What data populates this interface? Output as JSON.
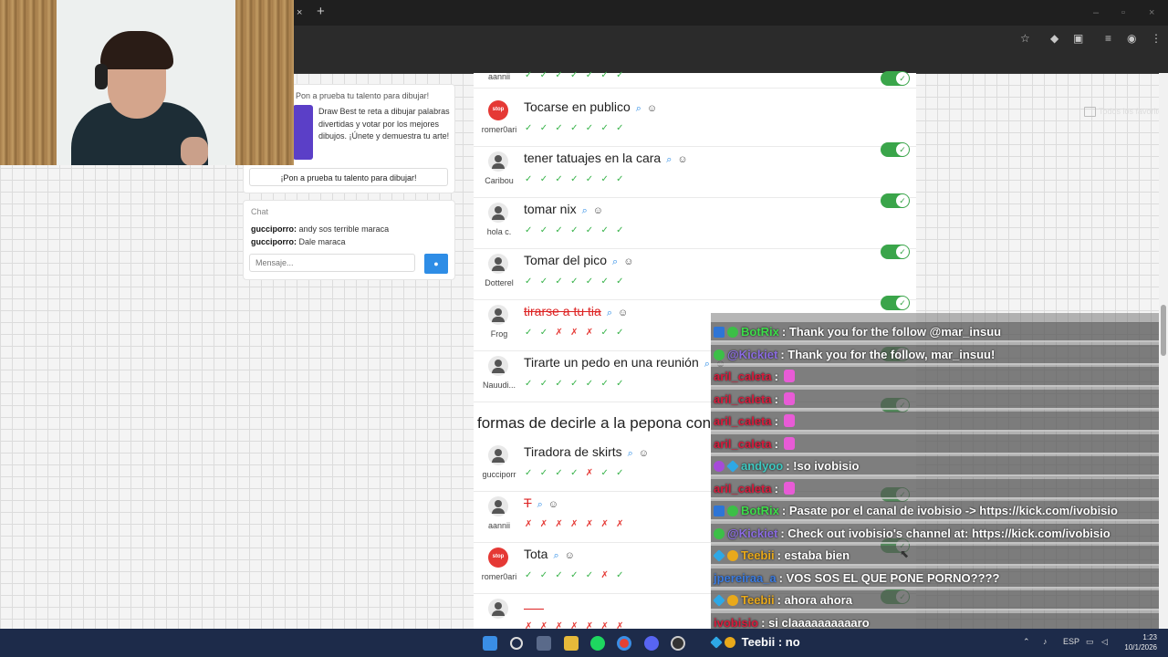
{
  "browser": {
    "tab_close": "×",
    "new_tab": "+",
    "bookmarks_folder_label": "Todos los favoritos"
  },
  "sidebar": {
    "promo_title": "Pon a prueba tu talento para dibujar!",
    "promo_text": "Draw Best te reta a dibujar palabras divertidas y votar por los mejores dibujos. ¡Únete y demuestra tu arte!",
    "promo_button": "¡Pon a prueba tu talento para dibujar!",
    "chat_title": "Chat",
    "chat_messages": [
      {
        "user": "gucciporro:",
        "text": "andy sos terrible maraca"
      },
      {
        "user": "gucciporro:",
        "text": "Dale maraca"
      }
    ],
    "chat_placeholder": "Mensaje..."
  },
  "list": {
    "top_partial_user": "aannii",
    "rows": [
      {
        "title": "Tocarse en publico",
        "user": "romer0ari",
        "stop": true,
        "marks": "✓✓✓✓✓✓✓"
      },
      {
        "title": "tener tatuajes en la cara",
        "user": "Caribou",
        "stop": false,
        "marks": "✓✓✓✓✓✓✓"
      },
      {
        "title": "tomar nix",
        "user": "hola c.",
        "stop": false,
        "marks": "✓✓✓✓✓✓✓"
      },
      {
        "title": "Tomar del pico",
        "user": "Dotterel",
        "stop": false,
        "marks": "✓✓✓✓✓✓✓"
      },
      {
        "title": "tirarse a tu tia",
        "user": "Frog",
        "stop": false,
        "strike": true,
        "marks": "✓✓✗✗✗✓✓"
      },
      {
        "title": "Tirarte un pedo en una reunión",
        "user": "Nauudi...",
        "stop": false,
        "marks": "✓✓✓✓✓✓✓"
      }
    ],
    "section_title": "formas de decirle a la pepona con",
    "rows2": [
      {
        "title": "Tiradora de skirts",
        "user": "gucciporr",
        "stop": false,
        "marks": "✓✓✓✓✗✓✓"
      },
      {
        "title": "T",
        "user": "aannii",
        "stop": false,
        "strike": true,
        "marks": "✗✗✗✗✗✗✗"
      },
      {
        "title": "Tota",
        "user": "romer0ari",
        "stop": true,
        "marks": "✓✓✓✓✓✗✓"
      },
      {
        "title": "",
        "user": "",
        "stop": false,
        "marks": "✗✗✗✗✗✗✗"
      }
    ],
    "stop_label": "stop"
  },
  "stream_chat": {
    "messages": [
      {
        "badges": [
          "bot",
          "ok"
        ],
        "nick": "BotRix",
        "nick_color": "#3ddc4a",
        "text": ": Thank you for the follow @mar_insuu"
      },
      {
        "badges": [
          "ok"
        ],
        "nick": "@Kickiet",
        "nick_color": "#8a6be0",
        "text": ": Thank you for the follow, mar_insuu!"
      },
      {
        "badges": [],
        "nick": "aril_caleta",
        "nick_color": "#d81b3c",
        "text": ":",
        "emote": true
      },
      {
        "badges": [],
        "nick": "aril_caleta",
        "nick_color": "#d81b3c",
        "text": ":",
        "emote": true
      },
      {
        "badges": [],
        "nick": "aril_caleta",
        "nick_color": "#d81b3c",
        "text": ":",
        "emote": true
      },
      {
        "badges": [],
        "nick": "aril_caleta",
        "nick_color": "#d81b3c",
        "text": ":",
        "emote": true
      },
      {
        "badges": [
          "gem",
          "hex"
        ],
        "nick": "andyoo",
        "nick_color": "#3ec9c1",
        "text": ": !so ivobisio"
      },
      {
        "badges": [],
        "nick": "aril_caleta",
        "nick_color": "#d81b3c",
        "text": ":",
        "emote": true
      },
      {
        "badges": [
          "bot",
          "ok"
        ],
        "nick": "BotRix",
        "nick_color": "#3ddc4a",
        "text": ": Pasate por el canal de ivobisio -> https://kick.com/ivobisio"
      },
      {
        "badges": [
          "ok"
        ],
        "nick": "@Kickiet",
        "nick_color": "#8a6be0",
        "text": ": Check out ivobisio's channel at: https://kick.com/ivobisio"
      },
      {
        "badges": [
          "hex",
          "gold"
        ],
        "nick": "Teebii",
        "nick_color": "#e9a91a",
        "text": ": estaba bien"
      },
      {
        "badges": [],
        "nick": "jpereiraa_a",
        "nick_color": "#3a7be0",
        "text": ": VOS SOS EL QUE PONE PORNO????"
      },
      {
        "badges": [
          "hex",
          "gold"
        ],
        "nick": "Teebii",
        "nick_color": "#e9a91a",
        "text": ": ahora ahora"
      },
      {
        "badges": [],
        "nick": "ivobisio",
        "nick_color": "#d81b3c",
        "text": ": si claaaaaaaaaaro"
      }
    ],
    "last": {
      "nick": "Teebii",
      "text": ": no"
    }
  },
  "taskbar": {
    "lang": "ESP",
    "time": "1:23",
    "date": "10/1/2026"
  }
}
